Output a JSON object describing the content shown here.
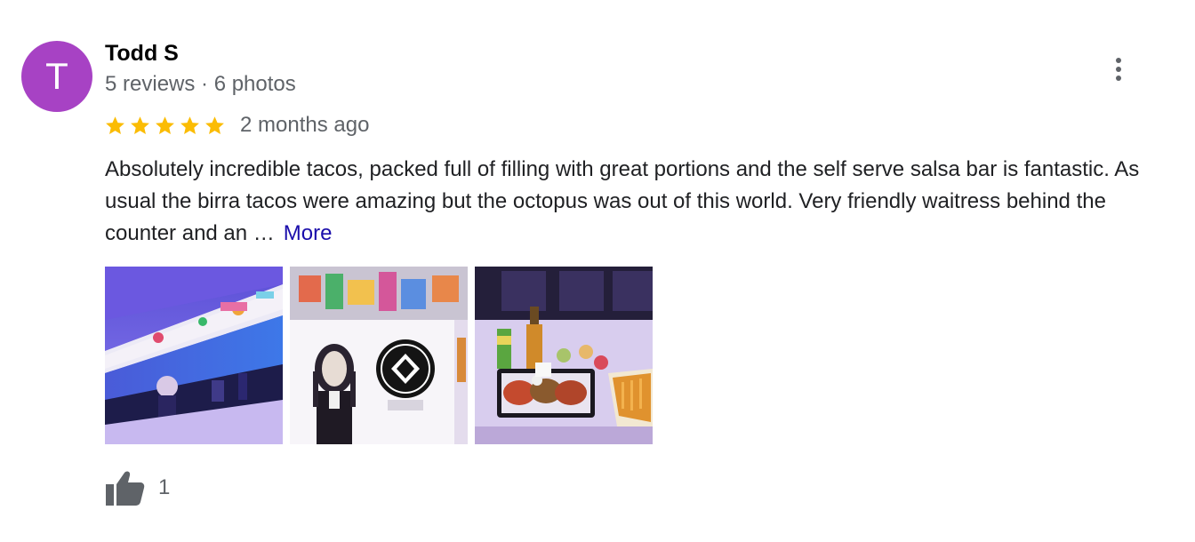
{
  "reviewer": {
    "initial": "T",
    "name": "Todd S",
    "meta": "5 reviews · 6 photos",
    "avatar_color": "#a742c4"
  },
  "menu": {
    "icon": "more-vert-icon"
  },
  "rating": {
    "stars": 5,
    "max": 5,
    "star_color": "#fbbc04",
    "date": "2 months ago"
  },
  "review": {
    "text": "Absolutely incredible tacos, packed full of filling with great portions and the self serve salsa bar is fantastic. As usual the birra tacos were amazing but the octopus was out of this world. Very friendly waitress behind the counter and an …",
    "more_label": "More",
    "more_color": "#1a0dab"
  },
  "photos": [
    {
      "icon": "photo-mural-wall"
    },
    {
      "icon": "photo-character-mural"
    },
    {
      "icon": "photo-taco-plate"
    }
  ],
  "likes": {
    "icon": "thumbs-up-icon",
    "count": "1"
  }
}
